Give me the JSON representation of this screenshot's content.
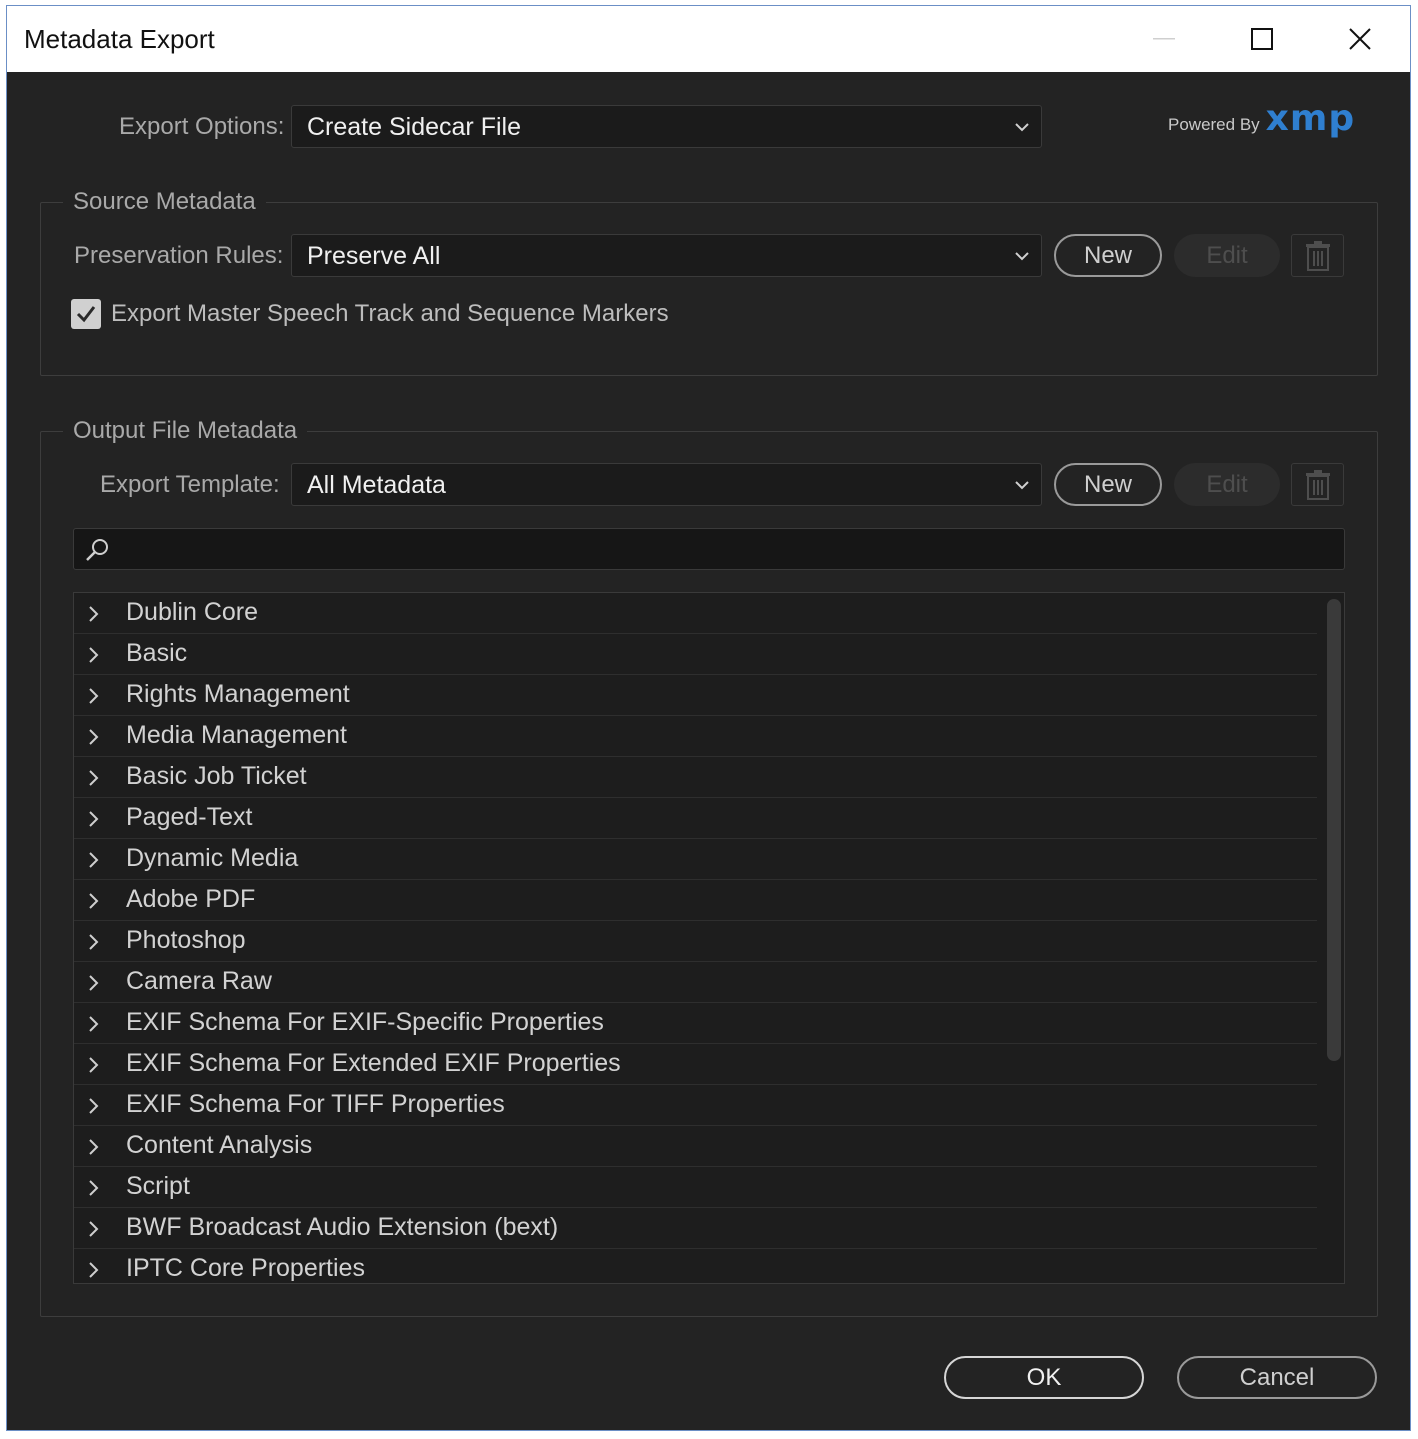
{
  "window": {
    "title": "Metadata Export"
  },
  "branding": {
    "powered_by": "Powered By",
    "logo": "xmp",
    "logo_color": "#2f7fd0"
  },
  "export_options": {
    "label": "Export Options:",
    "selected": "Create Sidecar File"
  },
  "source_metadata": {
    "group_title": "Source Metadata",
    "preservation_label": "Preservation Rules:",
    "preservation_selected": "Preserve All",
    "new_label": "New",
    "edit_label": "Edit",
    "checkbox_label": "Export Master Speech Track and Sequence Markers",
    "checkbox_checked": true
  },
  "output_metadata": {
    "group_title": "Output File Metadata",
    "template_label": "Export Template:",
    "template_selected": "All Metadata",
    "new_label": "New",
    "edit_label": "Edit",
    "search_placeholder": "",
    "items": [
      "Dublin Core",
      "Basic",
      "Rights Management",
      "Media Management",
      "Basic Job Ticket",
      "Paged-Text",
      "Dynamic Media",
      "Adobe PDF",
      "Photoshop",
      "Camera Raw",
      "EXIF Schema For EXIF-Specific Properties",
      "EXIF Schema For Extended EXIF Properties",
      "EXIF Schema For TIFF Properties",
      "Content Analysis",
      "Script",
      "BWF Broadcast Audio Extension (bext)",
      "IPTC Core Properties"
    ]
  },
  "footer": {
    "ok_label": "OK",
    "cancel_label": "Cancel"
  }
}
